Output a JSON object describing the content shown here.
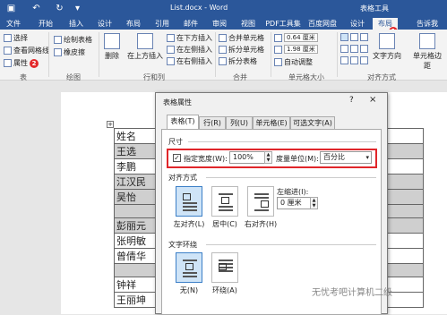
{
  "titlebar": {
    "save_icon": "save-icon",
    "undo_icon": "undo-icon",
    "redo_icon": "redo-icon",
    "document_title": "List.docx - Word",
    "context_tab_group": "表格工具"
  },
  "tabs": [
    "文件",
    "开始",
    "插入",
    "设计",
    "布局",
    "引用",
    "邮件",
    "审阅",
    "视图",
    "PDF工具集",
    "百度网盘",
    "设计",
    "布局",
    "告诉我"
  ],
  "active_tab_index": 12,
  "ribbon": {
    "select_label": "选择",
    "gridlines_label": "查看网格线",
    "properties_label": "属性",
    "group_table": "表",
    "draw_table_label": "绘制表格",
    "eraser_label": "橡皮擦",
    "group_draw": "绘图",
    "delete_label": "删除",
    "insert_above_label": "在上方插入",
    "insert_below_label": "在下方插入",
    "insert_left_label": "在左侧插入",
    "insert_right_label": "在右侧插入",
    "group_rows_cols": "行和列",
    "merge_cells_label": "合并单元格",
    "split_cells_label": "拆分单元格",
    "split_table_label": "拆分表格",
    "group_merge": "合并",
    "height_value": "0.64 厘米",
    "width_value": "1.98 厘米",
    "autofit_label": "自动调整",
    "group_cell_size": "单元格大小",
    "text_direction_label": "文字方向",
    "cell_margins_label": "单元格边距",
    "group_alignment": "对齐方式"
  },
  "badges": {
    "properties_step": "2",
    "layout_step": "1"
  },
  "document_table": {
    "names": [
      "姓名",
      "王选",
      "李鹏",
      "江汉民",
      "吴怡",
      "",
      "彭丽元",
      "张明敏",
      "曾倩华",
      "",
      "钟祥",
      "王丽坤"
    ],
    "shaded_rows": [
      1,
      3,
      4,
      5,
      6,
      9
    ]
  },
  "dialog": {
    "title": "表格属性",
    "help": "?",
    "close": "×",
    "tabs": [
      "表格(T)",
      "行(R)",
      "列(U)",
      "单元格(E)",
      "可选文字(A)"
    ],
    "size_section": "尺寸",
    "preferred_width_label": "指定宽度(W):",
    "preferred_width_checked": true,
    "width_value": "100%",
    "measure_in_label": "度量单位(M):",
    "measure_in_value": "百分比",
    "alignment_section": "对齐方式",
    "align_left": "左对齐(L)",
    "align_center": "居中(C)",
    "align_right": "右对齐(H)",
    "indent_label": "左缩进(I):",
    "indent_value": "0 厘米",
    "wrap_section": "文字环绕",
    "wrap_none": "无(N)",
    "wrap_around": "环绕(A)"
  },
  "watermark": "无忧考吧计算机二级"
}
